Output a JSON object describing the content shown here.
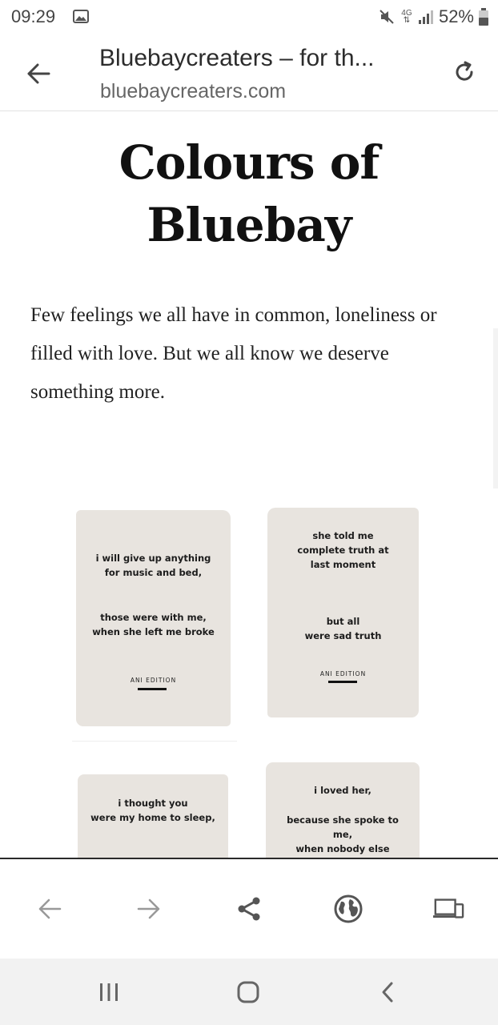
{
  "status_bar": {
    "time": "09:29",
    "network": "4G",
    "battery": "52%"
  },
  "browser": {
    "page_title": "Bluebaycreaters – for th...",
    "url": "bluebaycreaters.com"
  },
  "article": {
    "headline_line1": "Colours of",
    "headline_line2": "Bluebay",
    "intro": "Few feelings we all have in common, loneliness or filled with love. But we all know we deserve something more."
  },
  "cards": [
    {
      "lines_top": [
        "i will give up anything",
        "for music and bed,"
      ],
      "lines_bottom": [
        "those were with me,",
        "when she left me broke"
      ],
      "edition": "ANI EDITION"
    },
    {
      "lines_top": [
        "she told me",
        "complete truth at",
        "last moment"
      ],
      "lines_bottom": [
        "but all",
        "were sad truth"
      ],
      "edition": "ANI EDITION"
    },
    {
      "lines_top": [
        "i thought you",
        "were my home to sleep,"
      ]
    },
    {
      "lines_top": [
        "i loved her,"
      ],
      "lines_bottom": [
        "because she spoke to",
        "me,",
        "when nobody else"
      ]
    }
  ],
  "toolbar": {
    "icons": [
      "back-arrow-icon",
      "forward-arrow-icon",
      "share-icon",
      "globe-icon",
      "devices-icon"
    ]
  },
  "system_nav": {
    "icons": [
      "recent-apps-icon",
      "home-icon",
      "system-back-icon"
    ]
  },
  "colors": {
    "card_background": "#e8e4df",
    "text_dark": "#111111",
    "icon_gray": "#555555",
    "nav_background": "#f2f2f2"
  }
}
